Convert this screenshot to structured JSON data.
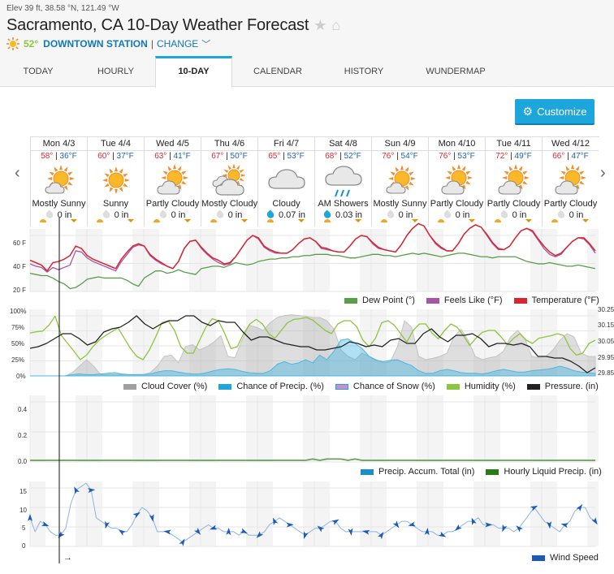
{
  "header": {
    "elevation": "Elev 39 ft, 38.58 °N, 121.49 °W",
    "title": "Sacramento, CA 10-Day Weather Forecast",
    "current_temp": "52°",
    "station": "DOWNTOWN STATION",
    "separator": "|",
    "change_label": "CHANGE"
  },
  "tabs": [
    {
      "label": "TODAY"
    },
    {
      "label": "HOURLY"
    },
    {
      "label": "10-DAY",
      "active": true
    },
    {
      "label": "CALENDAR"
    },
    {
      "label": "HISTORY"
    },
    {
      "label": "WUNDERMAP"
    }
  ],
  "customize_label": "Customize",
  "days": [
    {
      "name": "Mon 4/3",
      "hi": "58°",
      "lo": "36°F",
      "cond": "Mostly Sunny",
      "icon": "mostly-sunny",
      "precip": "0 in",
      "wet": false
    },
    {
      "name": "Tue 4/4",
      "hi": "60°",
      "lo": "37°F",
      "cond": "Sunny",
      "icon": "sunny",
      "precip": "0 in",
      "wet": false
    },
    {
      "name": "Wed 4/5",
      "hi": "63°",
      "lo": "41°F",
      "cond": "Partly Cloudy",
      "icon": "partly-cloudy",
      "precip": "0 in",
      "wet": false
    },
    {
      "name": "Thu 4/6",
      "hi": "67°",
      "lo": "50°F",
      "cond": "Mostly Cloudy",
      "icon": "mostly-cloudy",
      "precip": "0 in",
      "wet": false
    },
    {
      "name": "Fri 4/7",
      "hi": "65°",
      "lo": "53°F",
      "cond": "Cloudy",
      "icon": "cloudy",
      "precip": "0.07 in",
      "wet": true
    },
    {
      "name": "Sat 4/8",
      "hi": "68°",
      "lo": "52°F",
      "cond": "AM Showers",
      "icon": "showers",
      "precip": "0.03 in",
      "wet": true
    },
    {
      "name": "Sun 4/9",
      "hi": "76°",
      "lo": "54°F",
      "cond": "Mostly Sunny",
      "icon": "mostly-sunny",
      "precip": "0 in",
      "wet": false
    },
    {
      "name": "Mon 4/10",
      "hi": "76°",
      "lo": "53°F",
      "cond": "Partly Cloudy",
      "icon": "partly-cloudy",
      "precip": "0 in",
      "wet": false
    },
    {
      "name": "Tue 4/11",
      "hi": "72°",
      "lo": "49°F",
      "cond": "Partly Cloudy",
      "icon": "partly-cloudy",
      "precip": "0 in",
      "wet": false
    },
    {
      "name": "Wed 4/12",
      "hi": "66°",
      "lo": "47°F",
      "cond": "Partly Cloudy",
      "icon": "partly-cloudy",
      "precip": "0 in",
      "wet": false
    }
  ],
  "colors": {
    "temperature": "#d9262e",
    "feels_like": "#a855a8",
    "dew_point": "#5a9e4b",
    "cloud_cover": "#a0a0a0",
    "chance_precip": "#1ca6dc",
    "chance_snow": "#c98fc9",
    "humidity": "#8cc63f",
    "pressure": "#222222",
    "precip_total": "#1a8fc7",
    "hourly_precip": "#2a7a1a",
    "wind": "#1a5bb8",
    "accent": "#1ca6dc"
  },
  "chart_data": [
    {
      "type": "line",
      "title": "Temperature",
      "y_ticks": [
        "60 F",
        "40 F",
        "20 F"
      ],
      "ylim": [
        20,
        75
      ],
      "legend": [
        "Dew Point (°)",
        "Feels Like (°F)",
        "Temperature (°F)"
      ],
      "series": [
        {
          "name": "Temperature (°F)",
          "values": [
            45,
            43,
            41,
            36,
            43,
            44,
            46,
            49,
            57,
            55,
            49,
            46,
            44,
            42,
            40,
            38,
            46,
            52,
            57,
            59,
            57,
            50,
            46,
            43,
            40,
            38,
            44,
            55,
            61,
            62,
            56,
            51,
            47,
            45,
            42,
            43,
            48,
            55,
            62,
            66,
            64,
            57,
            54,
            52,
            51,
            51,
            54,
            59,
            63,
            64,
            61,
            56,
            55,
            53,
            52,
            52,
            57,
            63,
            66,
            65,
            60,
            56,
            54,
            53,
            52,
            58,
            66,
            72,
            76,
            74,
            66,
            60,
            56,
            53,
            53,
            59,
            67,
            72,
            75,
            73,
            67,
            60,
            55,
            54,
            57,
            64,
            70,
            72,
            70,
            63,
            57,
            52,
            49,
            51,
            56,
            61,
            64,
            64,
            59,
            53
          ]
        },
        {
          "name": "Feels Like (°F)",
          "values": [
            42,
            40,
            39,
            35,
            39,
            37,
            39,
            41,
            53,
            52,
            47,
            44,
            42,
            40,
            38,
            36,
            44,
            50,
            56,
            58,
            57,
            49,
            45,
            42,
            40,
            38,
            44,
            55,
            61,
            62,
            55,
            50,
            46,
            43,
            41,
            42,
            48,
            55,
            62,
            66,
            63,
            56,
            53,
            51,
            51,
            51,
            54,
            59,
            63,
            64,
            61,
            55,
            54,
            53,
            52,
            52,
            57,
            63,
            66,
            65,
            59,
            55,
            54,
            53,
            52,
            58,
            66,
            72,
            76,
            74,
            66,
            59,
            55,
            53,
            53,
            59,
            67,
            72,
            75,
            73,
            66,
            59,
            54,
            54,
            57,
            64,
            70,
            72,
            69,
            62,
            55,
            50,
            48,
            50,
            56,
            61,
            64,
            63,
            58,
            51
          ]
        },
        {
          "name": "Dew Point (°)",
          "values": [
            34,
            33,
            32,
            32,
            30,
            27,
            25,
            21,
            22,
            25,
            29,
            30,
            31,
            30,
            30,
            30,
            30,
            28,
            25,
            23,
            30,
            33,
            36,
            36,
            34,
            35,
            37,
            35,
            34,
            33,
            38,
            39,
            40,
            40,
            39,
            41,
            43,
            42,
            41,
            42,
            44,
            45,
            46,
            46,
            47,
            47,
            48,
            48,
            49,
            49,
            50,
            50,
            50,
            49,
            49,
            48,
            47,
            47,
            48,
            49,
            50,
            50,
            49,
            49,
            48,
            49,
            50,
            51,
            50,
            51,
            50,
            49,
            48,
            49,
            50,
            51,
            51,
            50,
            49,
            48,
            48,
            47,
            48,
            48,
            48,
            48,
            46,
            44,
            43,
            42,
            42,
            43,
            42,
            41,
            40,
            40,
            41,
            40,
            39,
            38
          ]
        }
      ]
    },
    {
      "type": "area",
      "title": "Sky / Humidity / Pressure",
      "y_ticks_left": [
        "100%",
        "75%",
        "50%",
        "25%",
        "0%"
      ],
      "y_ticks_right": [
        "30.25",
        "30.15",
        "30.05",
        "29.95",
        "29.85"
      ],
      "ylim_left": [
        0,
        100
      ],
      "ylim_right": [
        29.85,
        30.25
      ],
      "legend": [
        "Cloud Cover (%)",
        "Chance of Precip. (%)",
        "Chance of Snow (%)",
        "Humidity (%)",
        "Pressure. (in)"
      ],
      "series": [
        {
          "name": "Humidity (%)",
          "values": [
            66,
            68,
            69,
            78,
            92,
            62,
            50,
            38,
            25,
            32,
            45,
            55,
            62,
            68,
            74,
            58,
            42,
            30,
            25,
            40,
            60,
            82,
            85,
            70,
            45,
            35,
            35,
            55,
            75,
            88,
            85,
            65,
            42,
            45,
            65,
            80,
            87,
            80,
            65,
            58,
            70,
            82,
            87,
            88,
            90,
            86,
            78,
            70,
            65,
            80,
            85,
            85,
            76,
            55,
            45,
            58,
            82,
            85,
            78,
            65,
            52,
            70,
            80,
            80,
            66,
            57,
            70,
            80,
            75,
            62,
            47,
            58,
            67,
            70,
            70,
            60,
            48,
            58,
            65,
            55,
            50,
            58,
            60,
            62,
            65,
            62,
            42,
            32,
            35,
            50,
            55
          ],
          "note": "approximate"
        },
        {
          "name": "Pressure. (in)",
          "values": [
            30.02,
            30.03,
            30.05,
            30.08,
            30.11,
            30.11,
            30.08,
            30.04,
            30.06,
            30.12,
            30.14,
            30.15,
            30.18,
            30.22,
            30.17,
            30.14,
            30.17,
            30.19,
            30.19,
            30.22,
            30.22,
            30.18,
            30.16,
            30.19,
            30.18,
            30.18,
            30.12,
            30.07,
            30.09,
            30.09,
            30.07,
            30.05,
            30.04,
            30.03,
            30.03,
            30.01,
            30.01,
            30.02,
            30.03,
            30.06,
            30.05,
            30.03,
            30.04,
            30.03,
            30.07,
            30.08,
            30.05,
            30.05,
            30.11,
            30.14,
            30.09,
            30.06,
            30.1,
            30.1,
            30.11,
            30.08,
            30.03,
            30.05,
            30.05,
            30.04,
            30.05,
            30.03,
            29.97,
            29.97,
            29.96,
            29.96,
            29.94,
            29.91,
            29.87,
            29.9
          ]
        },
        {
          "name": "Cloud Cover (%)",
          "values": [
            0,
            0,
            0,
            0,
            0,
            0,
            5,
            15,
            25,
            15,
            2,
            2,
            2,
            2,
            2,
            2,
            2,
            5,
            15,
            30,
            32,
            20,
            45,
            48,
            40,
            45,
            52,
            62,
            30,
            28,
            55,
            78,
            75,
            70,
            82,
            90,
            93,
            94,
            93,
            92,
            90,
            90,
            85,
            72,
            40,
            30,
            25,
            35,
            30,
            25,
            20,
            22,
            45,
            85,
            75,
            30,
            25,
            27,
            30,
            35,
            60,
            72,
            55,
            30,
            25,
            28,
            30,
            38,
            60,
            70,
            58,
            30,
            28,
            30,
            40,
            55,
            65,
            60,
            35,
            30,
            30
          ],
          "note": "approximate"
        },
        {
          "name": "Chance of Precip. (%)",
          "values": [
            0,
            0,
            0,
            0,
            0,
            0,
            2,
            3,
            2,
            2,
            3,
            4,
            5,
            3,
            2,
            2,
            2,
            3,
            6,
            8,
            8,
            6,
            4,
            3,
            3,
            5,
            8,
            10,
            11,
            10,
            7,
            5,
            4,
            4,
            8,
            18,
            22,
            18,
            20,
            25,
            20,
            32,
            25,
            38,
            55,
            57,
            50,
            42,
            30,
            24,
            22,
            24,
            25,
            20,
            16,
            8,
            4,
            4,
            8,
            10,
            8,
            5,
            4,
            4,
            3,
            5,
            8,
            10,
            8,
            6,
            6,
            8,
            9,
            10,
            12,
            15,
            12,
            8,
            6,
            5,
            4
          ]
        },
        {
          "name": "Chance of Snow (%)",
          "values": [
            0
          ]
        }
      ]
    },
    {
      "type": "line",
      "title": "Precipitation",
      "y_ticks": [
        "0.4",
        "0.2",
        "0.0"
      ],
      "ylim": [
        0,
        0.5
      ],
      "legend": [
        "Precip. Accum. Total (in)",
        "Hourly Liquid Precip. (in)"
      ],
      "series": [
        {
          "name": "Hourly Liquid Precip. (in)",
          "values": [
            0,
            0,
            0,
            0,
            0,
            0,
            0,
            0,
            0,
            0,
            0,
            0,
            0,
            0,
            0,
            0,
            0,
            0,
            0,
            0,
            0,
            0,
            0,
            0,
            0,
            0,
            0,
            0,
            0,
            0,
            0,
            0,
            0,
            0,
            0,
            0,
            0,
            0,
            0,
            0,
            0.01,
            0,
            0.01,
            0.01,
            0.01,
            0,
            0.01,
            0,
            0,
            0,
            0,
            0,
            0,
            0,
            0,
            0,
            0,
            0,
            0,
            0,
            0,
            0,
            0,
            0,
            0,
            0,
            0,
            0,
            0,
            0,
            0,
            0,
            0,
            0,
            0,
            0,
            0,
            0,
            0,
            0,
            0
          ]
        },
        {
          "name": "Precip. Accum. Total (in)",
          "values": [
            0
          ]
        }
      ]
    },
    {
      "type": "line",
      "title": "Wind",
      "y_ticks": [
        "15",
        "10",
        "5",
        "0"
      ],
      "ylim": [
        0,
        18
      ],
      "legend": [
        "Wind Speed"
      ],
      "series": [
        {
          "name": "Wind Speed",
          "values": [
            8,
            4,
            7,
            6,
            4,
            3,
            3,
            5,
            12,
            16,
            17,
            18,
            16,
            8,
            7,
            6,
            5,
            5,
            4,
            4,
            6,
            9,
            11,
            10,
            8,
            4,
            4,
            4,
            3,
            2,
            1,
            2,
            3,
            4,
            5,
            6,
            5,
            5,
            4,
            4,
            4,
            3,
            4,
            3,
            3,
            3,
            4,
            6,
            7,
            8,
            7,
            6,
            5,
            4,
            3,
            4,
            5,
            5,
            6,
            7,
            7,
            5,
            4,
            4,
            4,
            4,
            4,
            4,
            4,
            3,
            4,
            5,
            6,
            7,
            7,
            6,
            5,
            4,
            4,
            4,
            3,
            3,
            4,
            4,
            5,
            6,
            7,
            7,
            8,
            6,
            6,
            6,
            5,
            5,
            5,
            4,
            5,
            7,
            9,
            11,
            9,
            7,
            6,
            5,
            4,
            6,
            7,
            10,
            11,
            11,
            8,
            7
          ]
        }
      ]
    }
  ],
  "nav": {
    "prev": "‹",
    "next": "›"
  },
  "extra": {
    "now_arrow": "→"
  }
}
